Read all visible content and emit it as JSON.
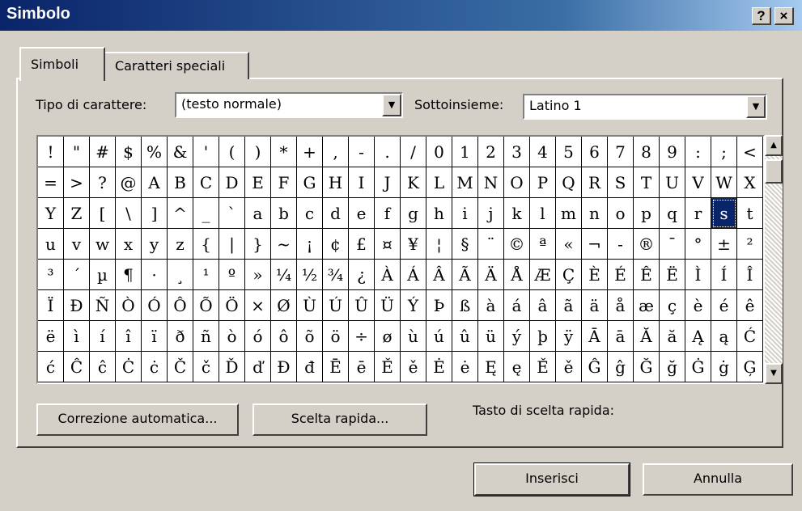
{
  "window": {
    "title": "Simbolo",
    "help_label": "?",
    "close_label": "×"
  },
  "tabs": [
    {
      "label": "Simboli",
      "active": true
    },
    {
      "label": "Caratteri speciali",
      "active": false
    }
  ],
  "font_picker": {
    "label": "Tipo di carattere:",
    "value": "(testo normale)"
  },
  "subset_picker": {
    "label": "Sottoinsieme:",
    "value": "Latino 1"
  },
  "symbol_grid": {
    "selected_index": 82,
    "rows": [
      [
        "!",
        "\"",
        "#",
        "$",
        "%",
        "&",
        "'",
        "(",
        ")",
        "*",
        "+",
        ",",
        "-",
        ".",
        "/",
        "0",
        "1",
        "2",
        "3",
        "4",
        "5",
        "6",
        "7",
        "8",
        "9",
        ":",
        ";",
        "<"
      ],
      [
        "=",
        ">",
        "?",
        "@",
        "A",
        "B",
        "C",
        "D",
        "E",
        "F",
        "G",
        "H",
        "I",
        "J",
        "K",
        "L",
        "M",
        "N",
        "O",
        "P",
        "Q",
        "R",
        "S",
        "T",
        "U",
        "V",
        "W",
        "X"
      ],
      [
        "Y",
        "Z",
        "[",
        "\\",
        "]",
        "^",
        "_",
        "`",
        "a",
        "b",
        "c",
        "d",
        "e",
        "f",
        "g",
        "h",
        "i",
        "j",
        "k",
        "l",
        "m",
        "n",
        "o",
        "p",
        "q",
        "r",
        "s",
        "t"
      ],
      [
        "u",
        "v",
        "w",
        "x",
        "y",
        "z",
        "{",
        "|",
        "}",
        "~",
        "¡",
        "¢",
        "£",
        "¤",
        "¥",
        "¦",
        "§",
        "¨",
        "©",
        "ª",
        "«",
        "¬",
        "-",
        "®",
        "¯",
        "°",
        "±",
        "²"
      ],
      [
        "³",
        "´",
        "µ",
        "¶",
        "·",
        "¸",
        "¹",
        "º",
        "»",
        "¼",
        "½",
        "¾",
        "¿",
        "À",
        "Á",
        "Â",
        "Ã",
        "Ä",
        "Å",
        "Æ",
        "Ç",
        "È",
        "É",
        "Ê",
        "Ë",
        "Ì",
        "Í",
        "Î"
      ],
      [
        "Ï",
        "Ð",
        "Ñ",
        "Ò",
        "Ó",
        "Ô",
        "Õ",
        "Ö",
        "×",
        "Ø",
        "Ù",
        "Ú",
        "Û",
        "Ü",
        "Ý",
        "Þ",
        "ß",
        "à",
        "á",
        "â",
        "ã",
        "ä",
        "å",
        "æ",
        "ç",
        "è",
        "é",
        "ê"
      ],
      [
        "ë",
        "ì",
        "í",
        "î",
        "ï",
        "ð",
        "ñ",
        "ò",
        "ó",
        "ô",
        "õ",
        "ö",
        "÷",
        "ø",
        "ù",
        "ú",
        "û",
        "ü",
        "ý",
        "þ",
        "ÿ",
        "Ā",
        "ā",
        "Ă",
        "ă",
        "Ą",
        "ą",
        "Ć"
      ],
      [
        "ć",
        "Ĉ",
        "ĉ",
        "Ċ",
        "ċ",
        "Č",
        "č",
        "Ď",
        "ď",
        "Đ",
        "đ",
        "Ē",
        "ē",
        "Ě",
        "ě",
        "Ė",
        "ė",
        "Ę",
        "ę",
        "Ě",
        "ě",
        "Ĝ",
        "ĝ",
        "Ğ",
        "ğ",
        "Ġ",
        "ġ",
        "Ģ"
      ]
    ]
  },
  "buttons": {
    "autocorrect": "Correzione automatica...",
    "shortcut_key": "Scelta rapida...",
    "insert": "Inserisci",
    "cancel": "Annulla"
  },
  "shortcut_label": "Tasto di scelta rapida:"
}
